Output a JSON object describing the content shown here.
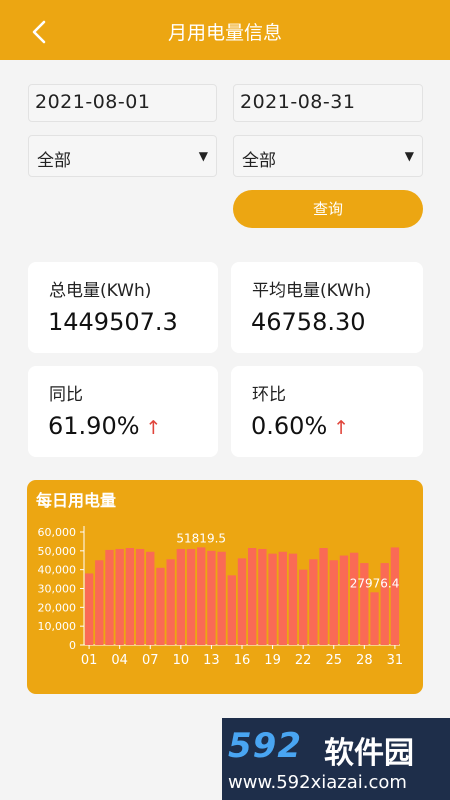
{
  "header": {
    "title": "月用电量信息"
  },
  "filters": {
    "start_date": "2021-08-01",
    "end_date": "2021-08-31",
    "select1": "全部",
    "select2": "全部",
    "query_label": "查询"
  },
  "cards": {
    "total": {
      "label": "总电量(KWh)",
      "value": "1449507.3"
    },
    "average": {
      "label": "平均电量(KWh)",
      "value": "46758.30"
    },
    "yoy": {
      "label": "同比",
      "value": "61.90%"
    },
    "mom": {
      "label": "环比",
      "value": "0.60%"
    }
  },
  "icons": {
    "back": "chevron-left-icon",
    "dropdown": "triangle-down-icon",
    "trend": "arrow-up-icon"
  },
  "colors": {
    "primary": "#eca612",
    "bar": "#fa6a55",
    "trend_up": "#e0453b"
  },
  "chart_data": {
    "type": "bar",
    "title": "每日用电量",
    "x": [
      "01",
      "02",
      "03",
      "04",
      "05",
      "06",
      "07",
      "08",
      "09",
      "10",
      "11",
      "12",
      "13",
      "14",
      "15",
      "16",
      "17",
      "18",
      "19",
      "20",
      "21",
      "22",
      "23",
      "24",
      "25",
      "26",
      "27",
      "28",
      "29",
      "30",
      "31"
    ],
    "x_tick_labels": [
      "01",
      "04",
      "07",
      "10",
      "13",
      "16",
      "19",
      "22",
      "25",
      "28",
      "31"
    ],
    "values": [
      38000,
      45000,
      50500,
      51000,
      51500,
      51000,
      49500,
      41000,
      45500,
      51000,
      51000,
      51819.5,
      50000,
      49500,
      37000,
      46000,
      51500,
      51000,
      48500,
      49500,
      48500,
      40000,
      45500,
      51500,
      45000,
      47500,
      49000,
      43500,
      27976.4,
      43500,
      51800
    ],
    "y_ticks": [
      0,
      10000,
      20000,
      30000,
      40000,
      50000,
      60000
    ],
    "y_tick_labels": [
      "0",
      "10,000",
      "20,000",
      "30,000",
      "40,000",
      "50,000",
      "60,000"
    ],
    "ylim": [
      0,
      60000
    ],
    "annotations": [
      {
        "x": "12",
        "value": 51819.5,
        "text": "51819.5"
      },
      {
        "x": "29",
        "value": 27976.4,
        "text": "27976.4"
      }
    ],
    "grid": false
  },
  "watermark": {
    "logo": "592",
    "name": "软件园",
    "url": "www.592xiazai.com"
  }
}
